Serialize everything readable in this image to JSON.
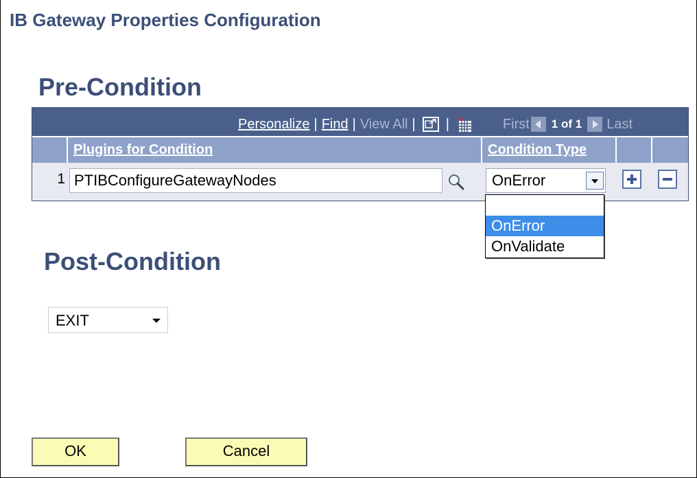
{
  "page": {
    "title": "IB Gateway Properties Configuration"
  },
  "pre_condition": {
    "heading": "Pre-Condition",
    "toolbar": {
      "personalize": "Personalize",
      "separator": "|",
      "find": "Find",
      "view_all": "View All",
      "first": "First",
      "count": "1 of 1",
      "last": "Last"
    },
    "columns": {
      "plugins": "Plugins for Condition",
      "condition_type": "Condition Type"
    },
    "rows": [
      {
        "num": "1",
        "plugin": "PTIBConfigureGatewayNodes",
        "condition_type": "OnError"
      }
    ],
    "dropdown_options": [
      "",
      "OnError",
      "OnValidate"
    ],
    "dropdown_selected": "OnError"
  },
  "post_condition": {
    "heading": "Post-Condition",
    "value": "EXIT"
  },
  "buttons": {
    "ok": "OK",
    "cancel": "Cancel"
  },
  "colors": {
    "heading": "#3c4f77",
    "toolbar_bg": "#4a5f8c",
    "header_bg": "#8ea2c9",
    "button_bg": "#fcfbb5",
    "selection": "#3d8ee8"
  },
  "icons": [
    "lookup-icon",
    "zoom-icon",
    "download-grid-icon",
    "prev-arrow-icon",
    "next-arrow-icon",
    "add-row-icon",
    "delete-row-icon",
    "chevron-down-icon"
  ]
}
